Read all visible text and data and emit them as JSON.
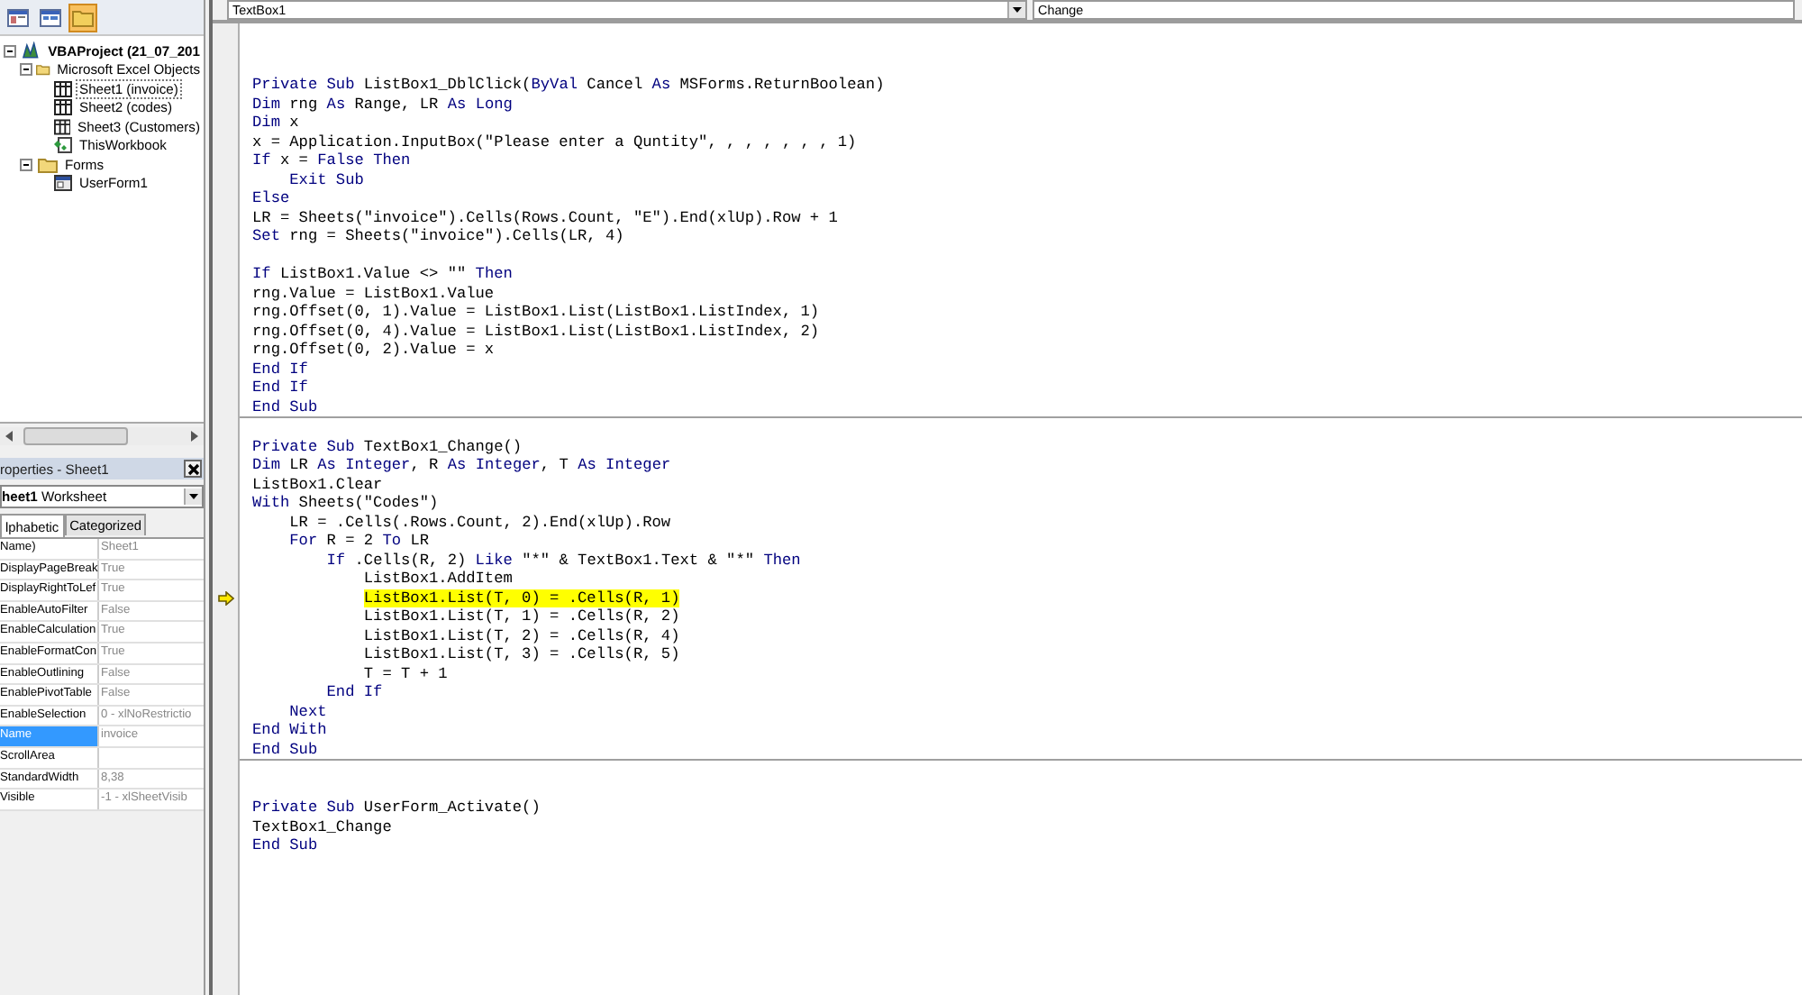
{
  "project_explorer": {
    "toolbar": [
      {
        "kind": "object",
        "selected": false
      },
      {
        "kind": "code",
        "selected": false
      },
      {
        "kind": "folders",
        "selected": true
      }
    ],
    "tree": [
      {
        "label": "VBAProject (21_07_201",
        "kind": "project",
        "expanded": true,
        "selected": false,
        "children": [
          {
            "label": "Microsoft Excel Objects",
            "kind": "folder",
            "expanded": true,
            "selected": false,
            "children": [
              {
                "label": "Sheet1 (invoice)",
                "kind": "sheet",
                "selected": true
              },
              {
                "label": "Sheet2 (codes)",
                "kind": "sheet",
                "selected": false
              },
              {
                "label": "Sheet3 (Customers)",
                "kind": "sheet",
                "selected": false
              },
              {
                "label": "ThisWorkbook",
                "kind": "workbook",
                "selected": false
              }
            ]
          },
          {
            "label": "Forms",
            "kind": "folder",
            "expanded": true,
            "selected": false,
            "children": [
              {
                "label": "UserForm1",
                "kind": "form",
                "selected": false
              }
            ]
          }
        ]
      }
    ]
  },
  "properties": {
    "title": "roperties - Sheet1",
    "object": {
      "name": "heet1",
      "type": "Worksheet"
    },
    "tabs": [
      {
        "label": "lphabetic",
        "selected": true
      },
      {
        "label": "Categorized",
        "selected": false
      }
    ],
    "rows": [
      {
        "name": "Name)",
        "value": "Sheet1",
        "selected": false
      },
      {
        "name": "DisplayPageBreak",
        "value": "True",
        "selected": false
      },
      {
        "name": "DisplayRightToLef",
        "value": "True",
        "selected": false
      },
      {
        "name": "EnableAutoFilter",
        "value": "False",
        "selected": false
      },
      {
        "name": "EnableCalculation",
        "value": "True",
        "selected": false
      },
      {
        "name": "EnableFormatCon",
        "value": "True",
        "selected": false
      },
      {
        "name": "EnableOutlining",
        "value": "False",
        "selected": false
      },
      {
        "name": "EnablePivotTable",
        "value": "False",
        "selected": false
      },
      {
        "name": "EnableSelection",
        "value": "0 - xlNoRestrictio",
        "selected": false
      },
      {
        "name": "Name",
        "value": "invoice",
        "selected": true
      },
      {
        "name": "ScrollArea",
        "selected": false
      },
      {
        "name": "StandardWidth",
        "value": "8,38",
        "selected": false
      },
      {
        "name": "Visible",
        "value": "-1 - xlSheetVisib",
        "selected": false
      }
    ]
  },
  "code_window": {
    "object_box": "TextBox1",
    "procedure_box": "Change",
    "procedures": [
      {
        "lines": [
          {
            "kind": "blank"
          },
          {
            "kind": "blank"
          },
          {
            "kind": "code",
            "current": false,
            "segments": [
              {
                "text": "Private Sub ",
                "keyword": true
              },
              {
                "text": "ListBox1_DblClick(",
                "keyword": false
              },
              {
                "text": "ByVal",
                "keyword": true
              },
              {
                "text": " Cancel ",
                "keyword": false
              },
              {
                "text": "As",
                "keyword": true
              },
              {
                "text": " MSForms.ReturnBoolean)",
                "keyword": false
              }
            ]
          },
          {
            "kind": "code",
            "current": false,
            "segments": [
              {
                "text": "Dim",
                "keyword": true
              },
              {
                "text": " rng ",
                "keyword": false
              },
              {
                "text": "As",
                "keyword": true
              },
              {
                "text": " Range, LR ",
                "keyword": false
              },
              {
                "text": "As Long",
                "keyword": true
              }
            ]
          },
          {
            "kind": "code",
            "current": false,
            "segments": [
              {
                "text": "Dim",
                "keyword": true
              },
              {
                "text": " x",
                "keyword": false
              }
            ]
          },
          {
            "kind": "code",
            "current": false,
            "segments": [
              {
                "text": "x = Application.InputBox(\"Please enter a Quntity\", , , , , , , 1)",
                "keyword": false
              }
            ]
          },
          {
            "kind": "code",
            "current": false,
            "segments": [
              {
                "text": "If",
                "keyword": true
              },
              {
                "text": " x = ",
                "keyword": false
              },
              {
                "text": "False Then",
                "keyword": true
              }
            ]
          },
          {
            "kind": "code",
            "current": false,
            "segments": [
              {
                "text": "    Exit Sub",
                "keyword": true
              }
            ]
          },
          {
            "kind": "code",
            "current": false,
            "segments": [
              {
                "text": "Else",
                "keyword": true
              }
            ]
          },
          {
            "kind": "code",
            "current": false,
            "segments": [
              {
                "text": "LR = Sheets(\"invoice\").Cells(Rows.Count, \"E\").End(xlUp).Row + 1",
                "keyword": false
              }
            ]
          },
          {
            "kind": "code",
            "current": false,
            "segments": [
              {
                "text": "Set",
                "keyword": true
              },
              {
                "text": " rng = Sheets(\"invoice\").Cells(LR, 4)",
                "keyword": false
              }
            ]
          },
          {
            "kind": "blank"
          },
          {
            "kind": "code",
            "current": false,
            "segments": [
              {
                "text": "If",
                "keyword": true
              },
              {
                "text": " ListBox1.Value <> \"\" ",
                "keyword": false
              },
              {
                "text": "Then",
                "keyword": true
              }
            ]
          },
          {
            "kind": "code",
            "current": false,
            "segments": [
              {
                "text": "rng.Value = ListBox1.Value",
                "keyword": false
              }
            ]
          },
          {
            "kind": "code",
            "current": false,
            "segments": [
              {
                "text": "rng.Offset(0, 1).Value = ListBox1.List(ListBox1.ListIndex, 1)",
                "keyword": false
              }
            ]
          },
          {
            "kind": "code",
            "current": false,
            "segments": [
              {
                "text": "rng.Offset(0, 4).Value = ListBox1.List(ListBox1.ListIndex, 2)",
                "keyword": false
              }
            ]
          },
          {
            "kind": "code",
            "current": false,
            "segments": [
              {
                "text": "rng.Offset(0, 2).Value = x",
                "keyword": false
              }
            ]
          },
          {
            "kind": "code",
            "current": false,
            "segments": [
              {
                "text": "End If",
                "keyword": true
              }
            ]
          },
          {
            "kind": "code",
            "current": false,
            "segments": [
              {
                "text": "End If",
                "keyword": true
              }
            ]
          },
          {
            "kind": "code",
            "current": false,
            "segments": [
              {
                "text": "End Sub",
                "keyword": true
              }
            ]
          }
        ]
      },
      {
        "lines": [
          {
            "kind": "blank"
          },
          {
            "kind": "code",
            "current": false,
            "segments": [
              {
                "text": "Private Sub ",
                "keyword": true
              },
              {
                "text": "TextBox1_Change()",
                "keyword": false
              }
            ]
          },
          {
            "kind": "code",
            "current": false,
            "segments": [
              {
                "text": "Dim",
                "keyword": true
              },
              {
                "text": " LR ",
                "keyword": false
              },
              {
                "text": "As Integer",
                "keyword": true
              },
              {
                "text": ", R ",
                "keyword": false
              },
              {
                "text": "As Integer",
                "keyword": true
              },
              {
                "text": ", T ",
                "keyword": false
              },
              {
                "text": "As Integer",
                "keyword": true
              }
            ]
          },
          {
            "kind": "code",
            "current": false,
            "segments": [
              {
                "text": "ListBox1.Clear",
                "keyword": false
              }
            ]
          },
          {
            "kind": "code",
            "current": false,
            "segments": [
              {
                "text": "With",
                "keyword": true
              },
              {
                "text": " Sheets(\"Codes\")",
                "keyword": false
              }
            ]
          },
          {
            "kind": "code",
            "current": false,
            "segments": [
              {
                "text": "    LR = .Cells(.Rows.Count, 2).End(xlUp).Row",
                "keyword": false
              }
            ]
          },
          {
            "kind": "code",
            "current": false,
            "segments": [
              {
                "text": "    For",
                "keyword": true
              },
              {
                "text": " R = 2 ",
                "keyword": false
              },
              {
                "text": "To",
                "keyword": true
              },
              {
                "text": " LR",
                "keyword": false
              }
            ]
          },
          {
            "kind": "code",
            "current": false,
            "segments": [
              {
                "text": "        If",
                "keyword": true
              },
              {
                "text": " .Cells(R, 2) ",
                "keyword": false
              },
              {
                "text": "Like",
                "keyword": true
              },
              {
                "text": " \"*\" & TextBox1.Text & \"*\" ",
                "keyword": false
              },
              {
                "text": "Then",
                "keyword": true
              }
            ]
          },
          {
            "kind": "code",
            "current": false,
            "segments": [
              {
                "text": "            ListBox1.AddItem",
                "keyword": false
              }
            ]
          },
          {
            "kind": "code",
            "current": true,
            "segments": [
              {
                "text": "            ListBox1.List(T, 0) = .Cells(R, 1)",
                "keyword": false
              }
            ]
          },
          {
            "kind": "code",
            "current": false,
            "segments": [
              {
                "text": "            ListBox1.List(T, 1) = .Cells(R, 2)",
                "keyword": false
              }
            ]
          },
          {
            "kind": "code",
            "current": false,
            "segments": [
              {
                "text": "            ListBox1.List(T, 2) = .Cells(R, 4)",
                "keyword": false
              }
            ]
          },
          {
            "kind": "code",
            "current": false,
            "segments": [
              {
                "text": "            ListBox1.List(T, 3) = .Cells(R, 5)",
                "keyword": false
              }
            ]
          },
          {
            "kind": "code",
            "current": false,
            "segments": [
              {
                "text": "            T = T + 1",
                "keyword": false
              }
            ]
          },
          {
            "kind": "code",
            "current": false,
            "segments": [
              {
                "text": "        End If",
                "keyword": true
              }
            ]
          },
          {
            "kind": "code",
            "current": false,
            "segments": [
              {
                "text": "    Next",
                "keyword": true
              }
            ]
          },
          {
            "kind": "code",
            "current": false,
            "segments": [
              {
                "text": "End With",
                "keyword": true
              }
            ]
          },
          {
            "kind": "code",
            "current": false,
            "segments": [
              {
                "text": "End Sub",
                "keyword": true
              }
            ]
          }
        ]
      },
      {
        "lines": [
          {
            "kind": "blank"
          },
          {
            "kind": "blank"
          },
          {
            "kind": "code",
            "current": false,
            "segments": [
              {
                "text": "Private Sub ",
                "keyword": true
              },
              {
                "text": "UserForm_Activate()",
                "keyword": false
              }
            ]
          },
          {
            "kind": "code",
            "current": false,
            "segments": [
              {
                "text": "TextBox1_Change",
                "keyword": false
              }
            ]
          },
          {
            "kind": "code",
            "current": false,
            "segments": [
              {
                "text": "End Sub",
                "keyword": true
              }
            ]
          }
        ]
      }
    ]
  }
}
